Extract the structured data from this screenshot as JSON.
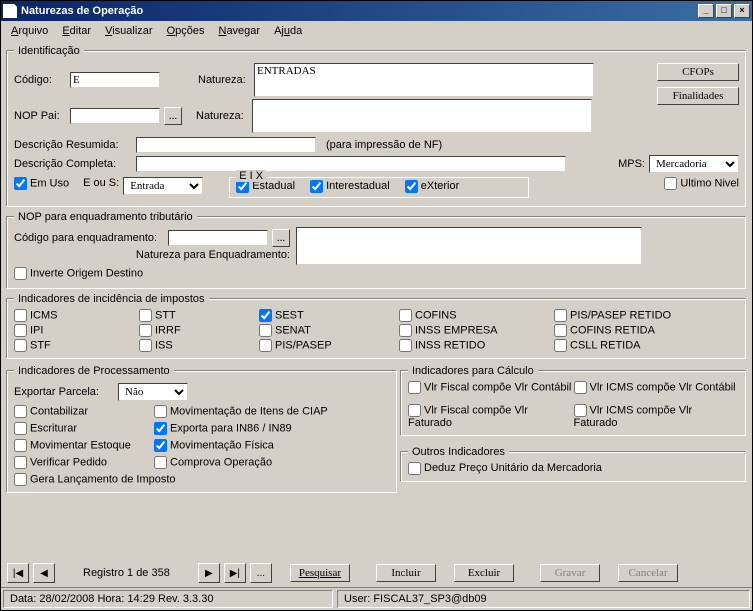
{
  "window": {
    "title": "Naturezas de Operação"
  },
  "menu": {
    "arquivo": "Arquivo",
    "editar": "Editar",
    "visualizar": "Visualizar",
    "opcoes": "Opções",
    "navegar": "Navegar",
    "ajuda": "Ajuda"
  },
  "ident": {
    "legend": "Identificação",
    "codigo_lbl": "Código:",
    "codigo_val": "E",
    "natureza_lbl": "Natureza:",
    "natureza_val": "ENTRADAS",
    "noppai_lbl": "NOP Pai:",
    "noppai_val": "",
    "natureza2_lbl": "Natureza:",
    "natureza2_val": "",
    "descres_lbl": "Descrição Resumida:",
    "descres_val": "",
    "descres_hint": "(para impressão de NF)",
    "desccomp_lbl": "Descrição Completa:",
    "desccomp_val": "",
    "mps_lbl": "MPS:",
    "mps_val": "Mercadoria",
    "emuso_lbl": "Em Uso",
    "eous_lbl": "E ou S:",
    "eous_val": "Entrada",
    "eix_lbl": "E I X",
    "estadual": "Estadual",
    "interestadual": "Interestadual",
    "exterior": "eXterior",
    "ultnivel": "Ultimo Nivel",
    "btn_cfops": "CFOPs",
    "btn_final": "Finalidades",
    "btn_dots": "..."
  },
  "nop": {
    "legend": "NOP para enquadramento tributário",
    "cod_lbl": "Código para enquadramento:",
    "cod_val": "",
    "nat_lbl": "Natureza para Enquadramento:",
    "nat_val": "",
    "inverte": "Inverte Origem Destino",
    "btn_dots": "..."
  },
  "imp": {
    "legend": "Indicadores de incidência de impostos",
    "items": {
      "icms": "ICMS",
      "ipi": "IPI",
      "stf": "STF",
      "stt": "STT",
      "irrf": "IRRF",
      "iss": "ISS",
      "sest": "SEST",
      "senat": "SENAT",
      "pispasep": "PIS/PASEP",
      "cofins": "COFINS",
      "inssemp": "INSS EMPRESA",
      "inssret": "INSS RETIDO",
      "pisret": "PIS/PASEP RETIDO",
      "cofret": "COFINS RETIDA",
      "csll": "CSLL RETIDA"
    }
  },
  "proc": {
    "legend": "Indicadores de Processamento",
    "exparc_lbl": "Exportar Parcela:",
    "exparc_val": "Não",
    "contab": "Contabilizar",
    "movciap": "Movimentação de Itens de CIAP",
    "escrit": "Escriturar",
    "expin86": "Exporta para IN86 / IN89",
    "movest": "Movimentar Estoque",
    "movfis": "Movimentação Física",
    "verped": "Verificar Pedido",
    "compop": "Comprova Operação",
    "geralanc": "Gera Lançamento de Imposto"
  },
  "calc": {
    "legend": "Indicadores para Cálculo",
    "vfc": "Vlr Fiscal compõe Vlr Contábil",
    "vicmsc": "Vlr ICMS compõe Vlr Contábil",
    "vff": "Vlr Fiscal compõe Vlr Faturado",
    "vicmsf": "Vlr ICMS compõe Vlr Faturado"
  },
  "outros": {
    "legend": "Outros Indicadores",
    "deduz": "Deduz Preço Unitário da Mercadoria"
  },
  "nav": {
    "registro": "Registro 1 de 358",
    "pesquisar": "Pesquisar",
    "incluir": "Incluir",
    "excluir": "Excluir",
    "gravar": "Gravar",
    "cancelar": "Cancelar"
  },
  "status": {
    "left": "Data: 28/02/2008   Hora: 14:29   Rev. 3.3.30",
    "user": "User:  FISCAL37_SP3@db09"
  }
}
